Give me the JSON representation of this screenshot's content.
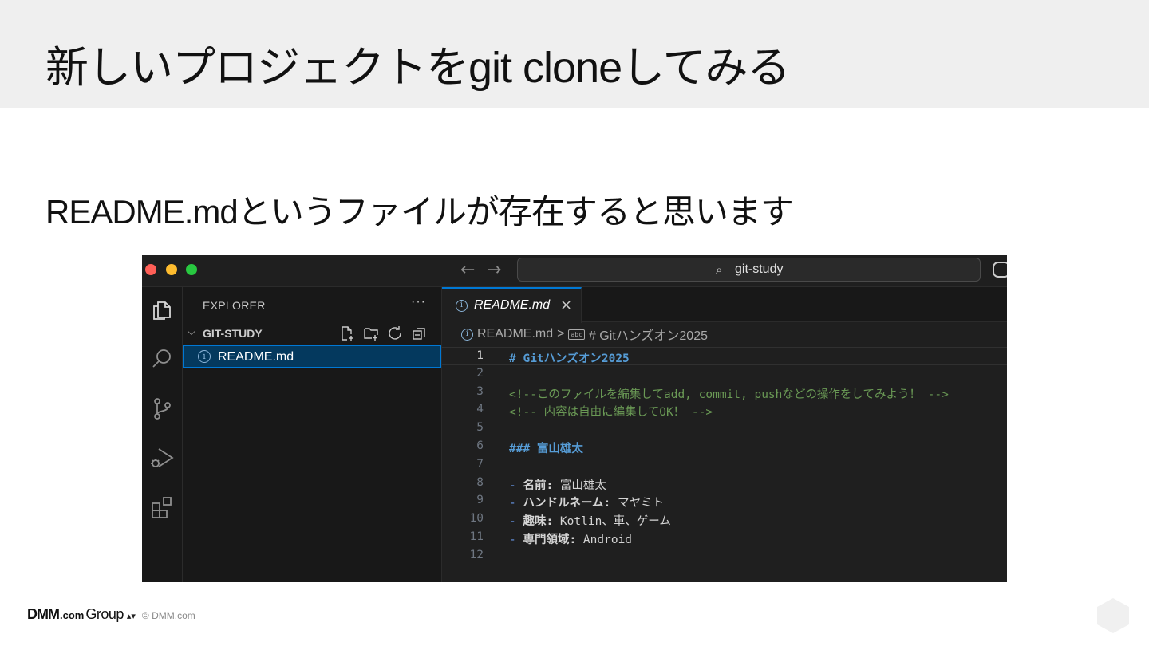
{
  "slide": {
    "title": "新しいプロジェクトをgit cloneしてみる",
    "subtitle": "README.mdというファイルが存在すると思います"
  },
  "titlebar": {
    "back_icon": "arrow-left-icon",
    "forward_icon": "arrow-right-icon",
    "search_text": "git-study"
  },
  "sidebar": {
    "title": "EXPLORER",
    "more": "···",
    "folder": "GIT-STUDY",
    "files": [
      {
        "name": "README.md",
        "icon": "info-icon",
        "selected": true
      }
    ]
  },
  "editor": {
    "tab_label": "README.md",
    "tab_close": "×",
    "breadcrumb": {
      "file": "README.md",
      "separator": ">",
      "symbol": "# Gitハンズオン2025"
    },
    "lines": [
      {
        "num": "1",
        "text": "# Gitハンズオン2025",
        "style": "heading",
        "current": true
      },
      {
        "num": "2",
        "text": "",
        "style": "plain"
      },
      {
        "num": "3",
        "text": "<!--このファイルを編集してadd, commit, pushなどの操作をしてみよう！ -->",
        "style": "comment"
      },
      {
        "num": "4",
        "text": "<!-- 内容は自由に編集してOK！ -->",
        "style": "comment"
      },
      {
        "num": "5",
        "text": "",
        "style": "plain"
      },
      {
        "num": "6",
        "text": "### 富山雄太",
        "style": "heading"
      },
      {
        "num": "7",
        "text": "",
        "style": "plain"
      },
      {
        "num": "8",
        "bullet": "- ",
        "key": "名前:",
        "value": " 富山雄太",
        "style": "item"
      },
      {
        "num": "9",
        "bullet": "- ",
        "key": "ハンドルネーム:",
        "value": " マヤミト",
        "style": "item"
      },
      {
        "num": "10",
        "bullet": "- ",
        "key": "趣味:",
        "value": " Kotlin、車、ゲーム",
        "style": "item"
      },
      {
        "num": "11",
        "bullet": "- ",
        "key": "専門領域:",
        "value": " Android",
        "style": "item"
      },
      {
        "num": "12",
        "text": "",
        "style": "plain"
      }
    ]
  },
  "footer": {
    "logo_dmm": "DMM",
    "logo_com": ".com",
    "logo_group": "Group",
    "copyright": "© DMM.com"
  }
}
